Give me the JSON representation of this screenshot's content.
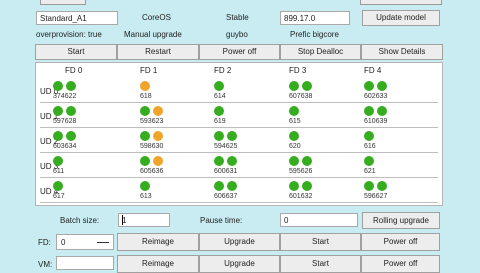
{
  "colors": {
    "healthy": "#36ad1f",
    "upgrading": "#f0a52a",
    "background": "#c8ecf2"
  },
  "info": {
    "model_name": "Standard_A1",
    "os": "CoreOS",
    "channel": "Stable",
    "version": "899.17.0",
    "update_model_label": "Update model",
    "overprovision": "overprovision: true",
    "upgrade_mode": "Manual upgrade",
    "user": "guybo",
    "prefix": "Prefic bigcore"
  },
  "actions": [
    "Start",
    "Restart",
    "Power off",
    "Stop Dealloc",
    "Show Details"
  ],
  "fault_domains": [
    "FD 0",
    "FD 1",
    "FD 2",
    "FD 3",
    "FD 4"
  ],
  "update_domains": [
    {
      "label": "UD 0",
      "cells": [
        {
          "vms": [
            {
              "id": "374",
              "state": "healthy"
            },
            {
              "id": "622",
              "state": "healthy"
            }
          ]
        },
        {
          "vms": [
            {
              "id": "618",
              "state": "upgrading"
            }
          ]
        },
        {
          "vms": [
            {
              "id": "614",
              "state": "healthy"
            }
          ]
        },
        {
          "vms": [
            {
              "id": "607",
              "state": "healthy"
            },
            {
              "id": "638",
              "state": "healthy"
            }
          ]
        },
        {
          "vms": [
            {
              "id": "602",
              "state": "healthy"
            },
            {
              "id": "633",
              "state": "healthy"
            }
          ]
        }
      ]
    },
    {
      "label": "UD 1",
      "cells": [
        {
          "vms": [
            {
              "id": "597",
              "state": "healthy"
            },
            {
              "id": "628",
              "state": "healthy"
            }
          ]
        },
        {
          "vms": [
            {
              "id": "593",
              "state": "healthy"
            },
            {
              "id": "623",
              "state": "upgrading"
            }
          ]
        },
        {
          "vms": [
            {
              "id": "619",
              "state": "healthy"
            }
          ]
        },
        {
          "vms": [
            {
              "id": "615",
              "state": "healthy"
            }
          ]
        },
        {
          "vms": [
            {
              "id": "610",
              "state": "healthy"
            },
            {
              "id": "639",
              "state": "healthy"
            }
          ]
        }
      ]
    },
    {
      "label": "UD 2",
      "cells": [
        {
          "vms": [
            {
              "id": "603",
              "state": "healthy"
            },
            {
              "id": "634",
              "state": "healthy"
            }
          ]
        },
        {
          "vms": [
            {
              "id": "598",
              "state": "healthy"
            },
            {
              "id": "630",
              "state": "upgrading"
            }
          ]
        },
        {
          "vms": [
            {
              "id": "594",
              "state": "healthy"
            },
            {
              "id": "625",
              "state": "healthy"
            }
          ]
        },
        {
          "vms": [
            {
              "id": "620",
              "state": "healthy"
            }
          ]
        },
        {
          "vms": [
            {
              "id": "616",
              "state": "healthy"
            }
          ]
        }
      ]
    },
    {
      "label": "UD 3",
      "cells": [
        {
          "vms": [
            {
              "id": "611",
              "state": "healthy"
            }
          ]
        },
        {
          "vms": [
            {
              "id": "605",
              "state": "healthy"
            },
            {
              "id": "636",
              "state": "upgrading"
            }
          ]
        },
        {
          "vms": [
            {
              "id": "600",
              "state": "healthy"
            },
            {
              "id": "631",
              "state": "healthy"
            }
          ]
        },
        {
          "vms": [
            {
              "id": "595",
              "state": "healthy"
            },
            {
              "id": "626",
              "state": "healthy"
            }
          ]
        },
        {
          "vms": [
            {
              "id": "621",
              "state": "healthy"
            }
          ]
        }
      ]
    },
    {
      "label": "UD 4",
      "cells": [
        {
          "vms": [
            {
              "id": "617",
              "state": "healthy"
            }
          ]
        },
        {
          "vms": [
            {
              "id": "613",
              "state": "healthy"
            }
          ]
        },
        {
          "vms": [
            {
              "id": "606",
              "state": "healthy"
            },
            {
              "id": "637",
              "state": "healthy"
            }
          ]
        },
        {
          "vms": [
            {
              "id": "601",
              "state": "healthy"
            },
            {
              "id": "632",
              "state": "healthy"
            }
          ]
        },
        {
          "vms": [
            {
              "id": "596",
              "state": "healthy"
            },
            {
              "id": "627",
              "state": "healthy"
            }
          ]
        }
      ]
    }
  ],
  "batch": {
    "label": "Batch size:",
    "value": "1",
    "pause_label": "Pause time:",
    "pause_value": "0",
    "rolling_label": "Rolling upgrade"
  },
  "fd_row": {
    "label": "FD:",
    "value": "0",
    "buttons": [
      "Reimage",
      "Upgrade",
      "Start",
      "Power off"
    ]
  },
  "vm_row": {
    "label": "VM:",
    "value": "",
    "buttons": [
      "Reimage",
      "Upgrade",
      "Start",
      "Power off"
    ]
  }
}
